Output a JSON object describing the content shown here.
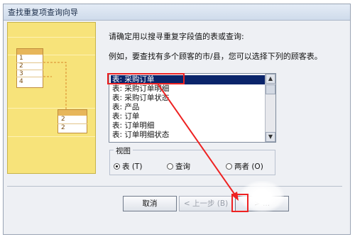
{
  "window": {
    "title": "查找重复项查询向导"
  },
  "art": {
    "numbers_left": [
      "1",
      "2",
      "3",
      "4"
    ],
    "numbers_right": [
      "2",
      "2"
    ]
  },
  "main": {
    "prompt1": "请确定用以搜寻重复字段值的表或查询:",
    "prompt2": "例如，要查找有多个顾客的市/县，您可以选择下列的顾客表。"
  },
  "list": {
    "items": [
      "表: 采购订单",
      "表: 采购订单明细",
      "表: 采购订单状态",
      "表: 产品",
      "表: 订单",
      "表: 订单明细",
      "表: 订单明细状态"
    ],
    "selected_index": 0
  },
  "view": {
    "label": "视图",
    "options": [
      "表 (T)",
      "查询",
      "两者 (O)"
    ],
    "selected": "表 (T)"
  },
  "buttons": {
    "cancel": "取消",
    "back": "< 上一步 (B)",
    "next": "> ..."
  },
  "colors": {
    "highlight_border": "#e22222",
    "selection_bg": "#0a246a",
    "art_bg": "#f7e37a"
  },
  "icons": {
    "scroll_up": "▲",
    "scroll_down": "▼"
  }
}
